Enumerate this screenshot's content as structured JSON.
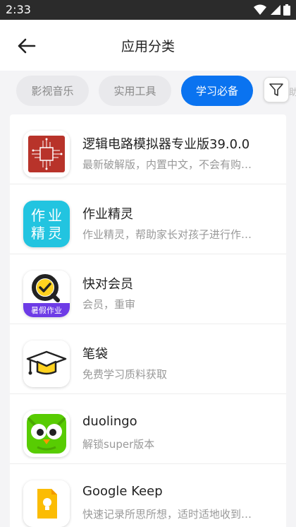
{
  "status": {
    "time": "2:33"
  },
  "header": {
    "title": "应用分类"
  },
  "tabs": [
    {
      "label": "影视音乐",
      "active": false
    },
    {
      "label": "实用工具",
      "active": false
    },
    {
      "label": "学习必备",
      "active": true
    },
    {
      "label": "助"
    }
  ],
  "apps": [
    {
      "name": "逻辑电路模拟器专业版39.0.0",
      "desc": "最新破解版，内置中文，不会有购…",
      "icon": "circuit-icon"
    },
    {
      "name": "作业精灵",
      "desc": "作业精灵，帮助家长对孩子进行作…",
      "icon": "zuoye-icon",
      "icon_text": [
        "作",
        "业",
        "精",
        "灵"
      ]
    },
    {
      "name": "快对会员",
      "desc": "会员，重审",
      "icon": "kuaidui-icon",
      "icon_text": "暑假作业"
    },
    {
      "name": "笔袋",
      "desc": "免费学习质料获取",
      "icon": "graduation-cap-icon"
    },
    {
      "name": "duolingo",
      "desc": "解锁super版本",
      "icon": "duolingo-owl-icon"
    },
    {
      "name": "Google Keep",
      "desc": "快速记录所思所想，适时适地收到…",
      "icon": "google-keep-icon"
    }
  ],
  "colors": {
    "accent": "#0a73f0"
  }
}
